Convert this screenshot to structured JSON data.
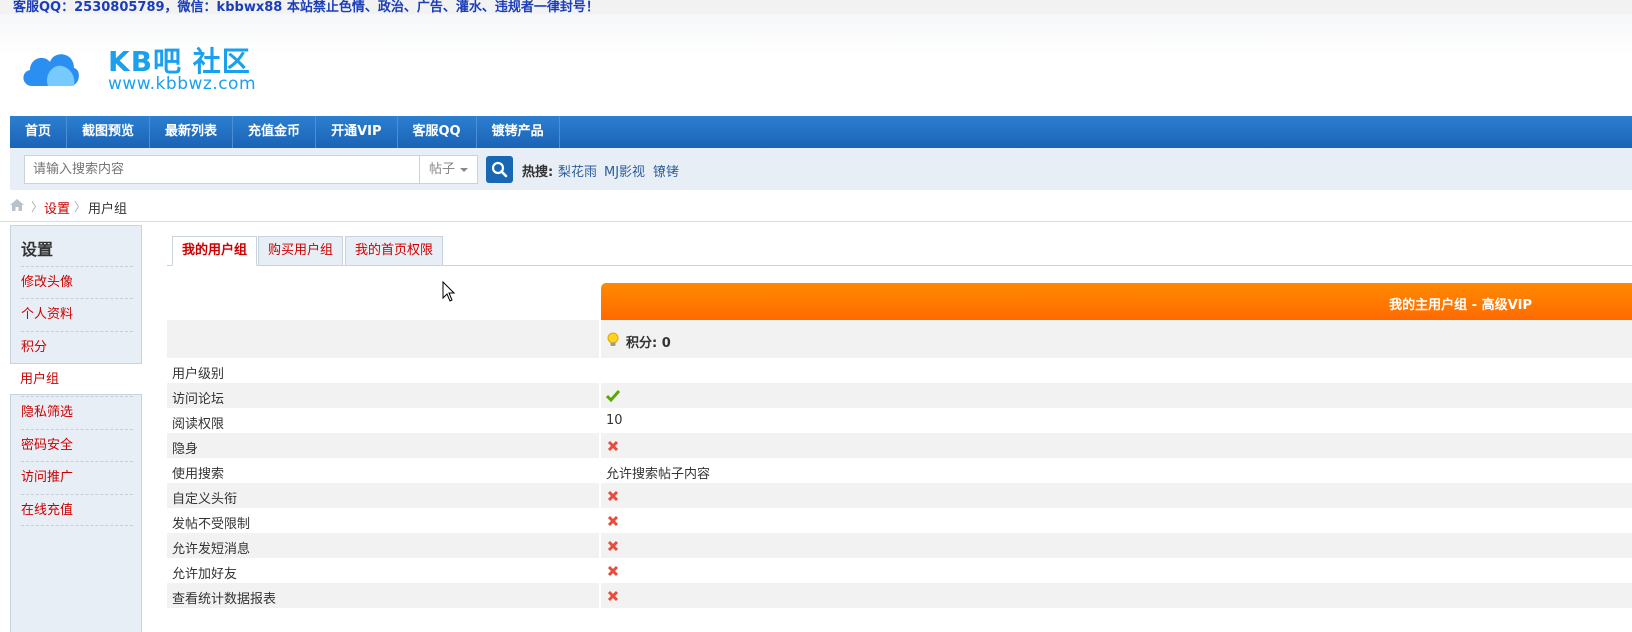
{
  "notice": "客服QQ：2530805789，微信：kbbwx88 本站禁止色情、政治、广告、灌水、违规者一律封号！",
  "logo": {
    "title": "KB吧 社区",
    "url": "www.kbbwz.com"
  },
  "nav": {
    "items": [
      "首页",
      "截图预览",
      "最新列表",
      "充值金币",
      "开通VIP",
      "客服QQ",
      "镀铐产品"
    ]
  },
  "search": {
    "placeholder": "请输入搜索内容",
    "type": "帖子",
    "hot_label": "热搜:",
    "hot_links": [
      "梨花雨",
      "MJ影视",
      "镣铐"
    ]
  },
  "breadcrumb": {
    "link": "设置",
    "current": "用户组"
  },
  "sidebar": {
    "title": "设置",
    "items": [
      "修改头像",
      "个人资料",
      "积分",
      "用户组",
      "隐私筛选",
      "密码安全",
      "访问推广",
      "在线充值"
    ],
    "active_index": 3
  },
  "tabs": [
    "我的用户组",
    "购买用户组",
    "我的首页权限"
  ],
  "group": {
    "header": "我的主用户组 - 高级VIP",
    "points": "积分: 0"
  },
  "permissions": [
    {
      "label": "用户级别",
      "value": "",
      "icon": ""
    },
    {
      "label": "访问论坛",
      "value": "",
      "icon": "check-icon"
    },
    {
      "label": "阅读权限",
      "value": "10",
      "icon": ""
    },
    {
      "label": "隐身",
      "value": "",
      "icon": "cross-icon"
    },
    {
      "label": "使用搜索",
      "value": "允许搜索帖子内容",
      "icon": ""
    },
    {
      "label": "自定义头衔",
      "value": "",
      "icon": "cross-icon"
    },
    {
      "label": "发帖不受限制",
      "value": "",
      "icon": "cross-icon"
    },
    {
      "label": "允许发短消息",
      "value": "",
      "icon": "cross-icon"
    },
    {
      "label": "允许加好友",
      "value": "",
      "icon": "cross-icon"
    },
    {
      "label": "查看统计数据报表",
      "value": "",
      "icon": "cross-icon"
    }
  ],
  "colors": {
    "brand": "#1aa0ee",
    "nav": "#1a63b5",
    "link": "#cc0000",
    "vip": "#ff7a00",
    "check": "#5aa800",
    "cross": "#e84c3d"
  }
}
